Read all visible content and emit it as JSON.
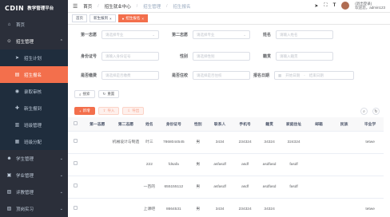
{
  "sidebar": {
    "logo": "CDIN",
    "title": "教学管理平台",
    "items": [
      {
        "label": "首页",
        "icon": "home-icon"
      },
      {
        "label": "招生管理",
        "icon": "users-icon",
        "expanded": true
      },
      {
        "label": "学生管理",
        "icon": "student-icon"
      },
      {
        "label": "学业管理",
        "icon": "book-icon"
      },
      {
        "label": "评教管理",
        "icon": "chart-icon"
      },
      {
        "label": "顶岗实习",
        "icon": "briefcase-icon"
      }
    ],
    "subitems": [
      {
        "label": "招生计划",
        "icon": "send-icon"
      },
      {
        "label": "招生报名",
        "icon": "form-icon",
        "active": true
      },
      {
        "label": "录取审核",
        "icon": "check-icon"
      },
      {
        "label": "新生报到",
        "icon": "user-add-icon"
      },
      {
        "label": "班级管理",
        "icon": "class-icon"
      },
      {
        "label": "班级分配",
        "icon": "grid-icon"
      }
    ]
  },
  "topbar": {
    "breadcrumbs": [
      "首页",
      "招生就业中心",
      "招生管理",
      "招生报名"
    ],
    "user_line1": "(退出登录)",
    "user_line2": "欢迎您，admin123"
  },
  "tags": {
    "items": [
      {
        "label": "首页",
        "active": false
      },
      {
        "label": "新生报到",
        "active": false
      },
      {
        "label": "招生报名",
        "active": true
      }
    ]
  },
  "form": {
    "first_choice_label": "第一志愿",
    "first_choice_placeholder": "请选择专业",
    "second_choice_label": "第二志愿",
    "second_choice_placeholder": "请选择专业",
    "name_label": "姓名",
    "name_placeholder": "请输入姓名",
    "idcard_label": "身份证号",
    "idcard_placeholder": "请输入身份证号",
    "gender_label": "性别",
    "gender_placeholder": "请选择性别",
    "origin_label": "籍贯",
    "origin_placeholder": "请输入籍贯",
    "paid_label": "是否缴费",
    "paid_placeholder": "请选择是否缴费",
    "stay_label": "是否住校",
    "stay_placeholder": "请选择是否住校",
    "date_label": "报名日期",
    "date_start": "开始日期",
    "date_sep": "-",
    "date_end": "结束日期"
  },
  "buttons": {
    "search": "搜索",
    "reset": "重置",
    "add": "新增",
    "import": "导入",
    "export": "导出"
  },
  "table": {
    "headers": [
      "第一志愿",
      "第二志愿",
      "姓名",
      "身份证号",
      "性别",
      "联系人",
      "手机号",
      "籍贯",
      "家庭住址",
      "邮箱",
      "民族",
      "毕业学"
    ],
    "rows": [
      [
        "",
        "机械设计与制造",
        "叶三",
        "7868044545",
        "男",
        "3434",
        "234324",
        "34324",
        "324324",
        "",
        "",
        "tetwe"
      ],
      [
        "",
        "",
        "222",
        "fdsafa",
        "男",
        "asfasdf",
        "asdf",
        "asdfasd",
        "fasdf",
        "",
        "",
        ""
      ],
      [
        "",
        "",
        "一百的",
        "655155112",
        "男",
        "asfasdf",
        "asdf",
        "asdfasd",
        "fasdf",
        "",
        "",
        ""
      ],
      [
        "",
        "",
        "上课吧",
        "8664531",
        "男",
        "3434",
        "234324",
        "34324",
        "",
        "",
        "",
        "tetwe"
      ]
    ]
  },
  "colors": {
    "accent": "#f36f4c",
    "sidebar_bg": "#2b2f3a",
    "submenu_bg": "#1f2d3d"
  }
}
